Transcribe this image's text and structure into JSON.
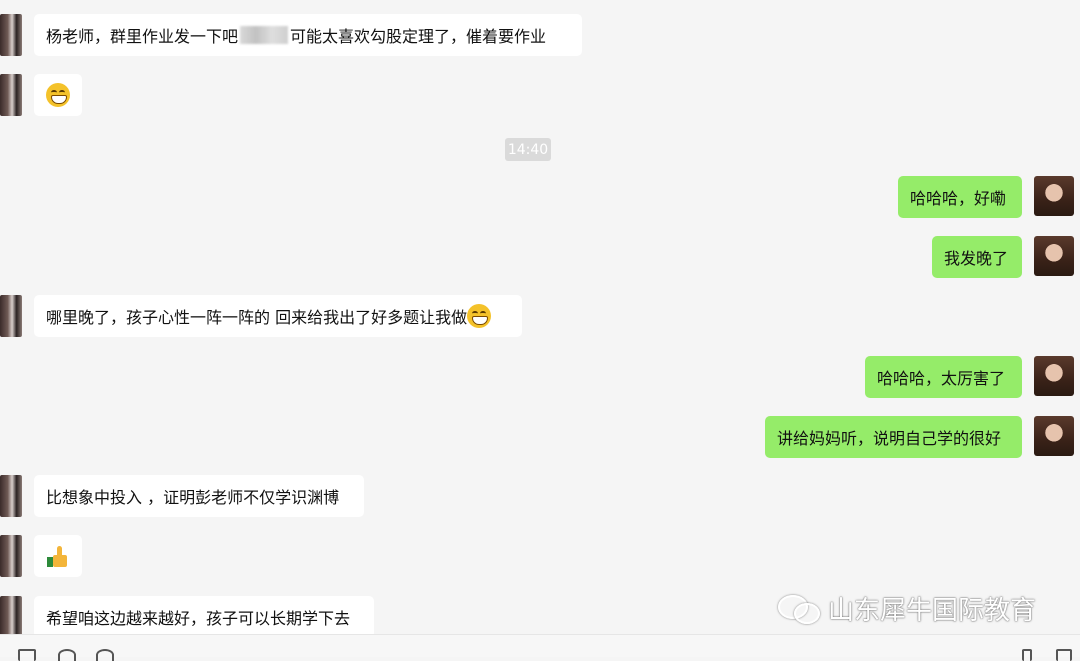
{
  "messages": [
    {
      "side": "left",
      "text_before": "杨老师，群里作业发一下吧",
      "redacted": true,
      "text_after": "可能太喜欢勾股定理了，催着要作业"
    },
    {
      "side": "left",
      "emoji": "grinning-face"
    },
    {
      "side": "right",
      "text": "哈哈哈，好嘞"
    },
    {
      "side": "right",
      "text": "我发晚了"
    },
    {
      "side": "left",
      "text": "哪里晚了，孩子心性一阵一阵的 回来给我出了好多题让我做",
      "emoji": "grinning-face"
    },
    {
      "side": "right",
      "text": "哈哈哈，太厉害了"
    },
    {
      "side": "right",
      "text": "讲给妈妈听，说明自己学的很好"
    },
    {
      "side": "left",
      "text": "比想象中投入 ，证明彭老师不仅学识渊博"
    },
    {
      "side": "left",
      "emoji": "thumbs-up"
    },
    {
      "side": "left",
      "text": "希望咱这边越来越好，孩子可以长期学下去"
    }
  ],
  "timestamp": "14:40",
  "watermark": {
    "icon": "wechat-icon",
    "text": "山东犀牛国际教育"
  },
  "colors": {
    "background": "#f5f5f5",
    "left_bubble": "#ffffff",
    "right_bubble": "#95ec69",
    "timestamp_bg": "#dadada"
  }
}
